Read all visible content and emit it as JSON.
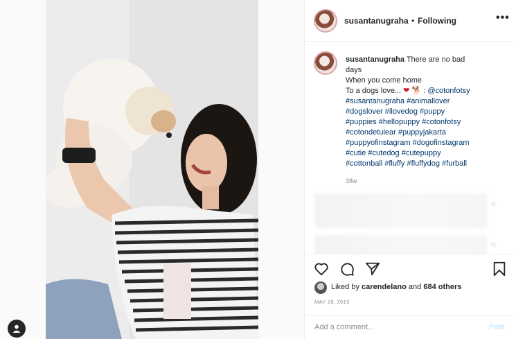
{
  "post": {
    "username": "susantanugraha",
    "separator": "•",
    "follow_state": "Following",
    "more_label": "•••"
  },
  "caption": {
    "username": "susantanugraha",
    "line1": "There are no bad",
    "line2": "days",
    "line3": "When you come home",
    "line4_text": "To a dogs love...",
    "line4_colon": ":",
    "mention": "@cotonfotsy",
    "hashtag_lines": [
      "#susantanugraha #animallover",
      "#dogslover #ilovedog #puppy",
      "#puppies #hellopuppy #cotonfotsy",
      "#cotondetulear #puppyjakarta",
      "#puppyofinstagram #dogofinstagram",
      "#cutie #cutedog #cutepuppy",
      "#cottonball #fluffy #fluffydog #furball"
    ],
    "age": "38w"
  },
  "likes": {
    "prefix": "Liked by",
    "user": "carendelano",
    "middle": "and",
    "count": "684 others"
  },
  "date": "MAY 28, 2019",
  "comment": {
    "placeholder": "Add a comment...",
    "post_label": "Post"
  },
  "icons": {
    "like": "heart-icon",
    "comment": "comment-icon",
    "share": "paper-plane-icon",
    "save": "bookmark-icon",
    "profile": "user-avatar-icon"
  },
  "colors": {
    "hashtag": "#00376b",
    "post_disabled": "#b2dffc",
    "heart_emoji": "#d11a2a"
  }
}
